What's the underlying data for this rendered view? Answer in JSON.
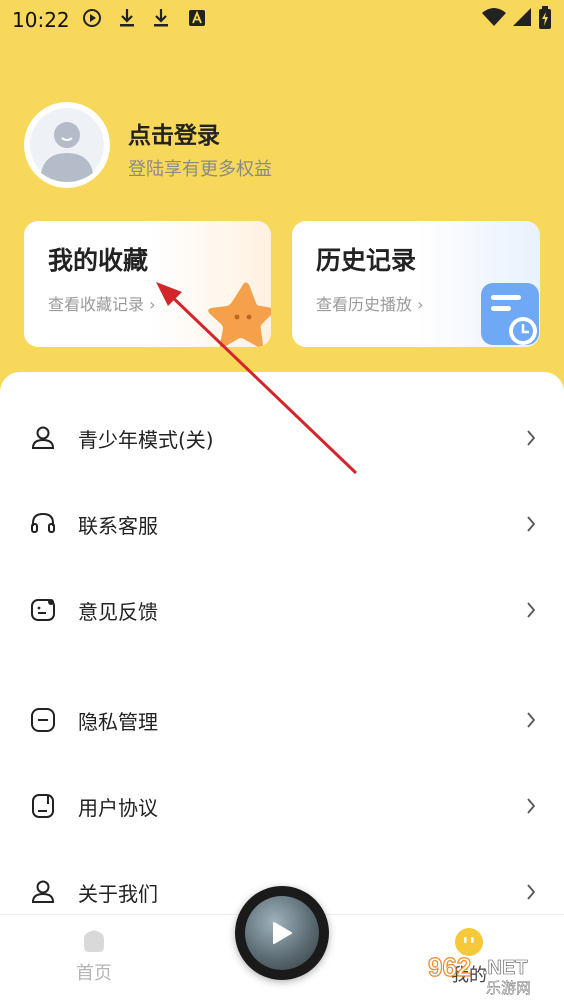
{
  "status_bar": {
    "time": "10:22"
  },
  "profile": {
    "title": "点击登录",
    "subtitle": "登陆享有更多权益"
  },
  "cards": [
    {
      "title": "我的收藏",
      "subtitle": "查看收藏记录 ›"
    },
    {
      "title": "历史记录",
      "subtitle": "查看历史播放 ›"
    }
  ],
  "menu": [
    {
      "label": "青少年模式(关)",
      "icon": "teen-icon"
    },
    {
      "label": "联系客服",
      "icon": "headset-icon"
    },
    {
      "label": "意见反馈",
      "icon": "feedback-icon"
    },
    {
      "label": "隐私管理",
      "icon": "privacy-icon"
    },
    {
      "label": "用户协议",
      "icon": "agreement-icon"
    },
    {
      "label": "关于我们",
      "icon": "about-icon"
    }
  ],
  "tabbar": {
    "home": "首页",
    "mine": "我的"
  },
  "watermark": "962.NET 乐游网",
  "colors": {
    "header_bg": "#f7d85a",
    "accent_orange": "#f5a04a",
    "blue_icon": "#6fa8f5"
  }
}
